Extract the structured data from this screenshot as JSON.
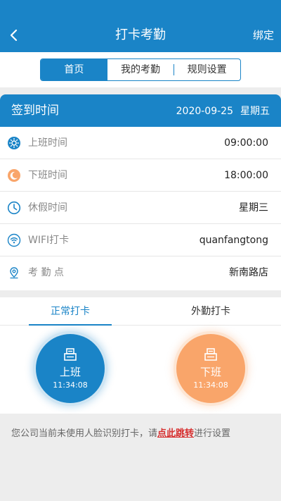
{
  "header": {
    "title": "打卡考勤",
    "back_icon": "chevron-left-icon",
    "bind_label": "绑定"
  },
  "tabs": [
    {
      "label": "首页",
      "active": true
    },
    {
      "label": "我的考勤",
      "active": false
    },
    {
      "label": "规则设置",
      "active": false
    }
  ],
  "sign_card": {
    "title": "签到时间",
    "date": "2020-09-25",
    "weekday": "星期五",
    "rows": [
      {
        "icon": "sun-icon",
        "label": "上班时间",
        "value": "09:00:00"
      },
      {
        "icon": "moon-icon",
        "label": "下班时间",
        "value": "18:00:00"
      },
      {
        "icon": "clock-icon",
        "label": "休假时间",
        "value": "星期三"
      },
      {
        "icon": "wifi-icon",
        "label": "WIFI打卡",
        "value": "quanfangtong"
      },
      {
        "icon": "location-pin-icon",
        "label": "考 勤 点",
        "value": "新南路店"
      }
    ]
  },
  "punch": {
    "tabs": [
      {
        "label": "正常打卡",
        "active": true
      },
      {
        "label": "外勤打卡",
        "active": false
      }
    ],
    "buttons": [
      {
        "label": "上班",
        "time": "11:34:08",
        "icon": "clipboard-icon"
      },
      {
        "label": "下班",
        "time": "11:34:08",
        "icon": "clipboard-icon"
      }
    ]
  },
  "notice": {
    "before": "您公司当前未使用人脸识别打卡，请",
    "link": "点此跳转",
    "after": "进行设置"
  },
  "colors": {
    "primary": "#1a84c7",
    "orange": "#f9a56a",
    "link": "#d62f2f",
    "background": "#ededed"
  }
}
